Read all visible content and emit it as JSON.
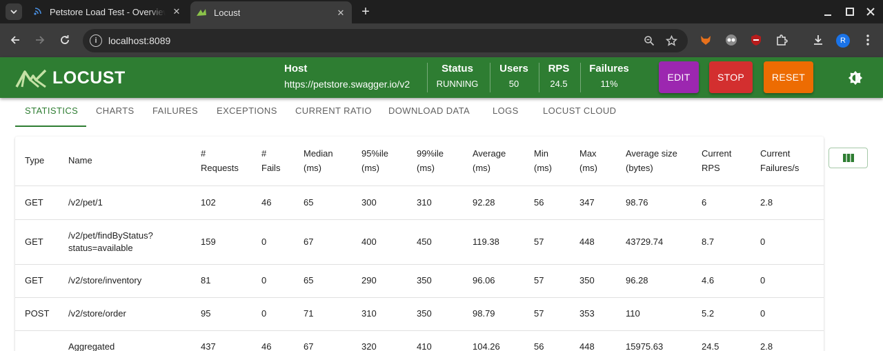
{
  "browser": {
    "tabs": [
      {
        "title": "Petstore Load Test - Overview",
        "active": false
      },
      {
        "title": "Locust",
        "active": true
      }
    ],
    "address": "localhost:8089",
    "profile_initial": "R"
  },
  "header": {
    "logo_text": "LOCUST",
    "host_label": "Host",
    "host_value": "https://petstore.swagger.io/v2",
    "status_label": "Status",
    "status_value": "RUNNING",
    "users_label": "Users",
    "users_value": "50",
    "rps_label": "RPS",
    "rps_value": "24.5",
    "failures_label": "Failures",
    "failures_value": "11%",
    "edit_label": "EDIT",
    "stop_label": "STOP",
    "reset_label": "RESET",
    "colors": {
      "header": "#2e7d32",
      "edit": "#9c27b0",
      "stop": "#d32f2f",
      "reset": "#ed6c02"
    }
  },
  "tabs": [
    "STATISTICS",
    "CHARTS",
    "FAILURES",
    "EXCEPTIONS",
    "CURRENT RATIO",
    "DOWNLOAD DATA",
    "LOGS",
    "LOCUST CLOUD"
  ],
  "active_tab": "STATISTICS",
  "table": {
    "headers": [
      [
        "Type"
      ],
      [
        "Name"
      ],
      [
        "#",
        "Requests"
      ],
      [
        "#",
        "Fails"
      ],
      [
        "Median",
        "(ms)"
      ],
      [
        "95%ile",
        "(ms)"
      ],
      [
        "99%ile",
        "(ms)"
      ],
      [
        "Average",
        "(ms)"
      ],
      [
        "Min",
        "(ms)"
      ],
      [
        "Max",
        "(ms)"
      ],
      [
        "Average size",
        "(bytes)"
      ],
      [
        "Current",
        "RPS"
      ],
      [
        "Current",
        "Failures/s"
      ]
    ],
    "rows": [
      {
        "cells": [
          "GET",
          "/v2/pet/1",
          "102",
          "46",
          "65",
          "300",
          "310",
          "92.28",
          "56",
          "347",
          "98.76",
          "6",
          "2.8"
        ]
      },
      {
        "cells": [
          "GET",
          "/v2/pet/findByStatus?",
          "159",
          "0",
          "67",
          "400",
          "450",
          "119.38",
          "57",
          "448",
          "43729.74",
          "8.7",
          "0"
        ],
        "name_line2": "status=available"
      },
      {
        "cells": [
          "GET",
          "/v2/store/inventory",
          "81",
          "0",
          "65",
          "290",
          "350",
          "96.06",
          "57",
          "350",
          "96.28",
          "4.6",
          "0"
        ]
      },
      {
        "cells": [
          "POST",
          "/v2/store/order",
          "95",
          "0",
          "71",
          "310",
          "350",
          "98.79",
          "57",
          "353",
          "110",
          "5.2",
          "0"
        ]
      },
      {
        "cells": [
          "",
          "Aggregated",
          "437",
          "46",
          "67",
          "320",
          "410",
          "104.26",
          "56",
          "448",
          "15975.63",
          "24.5",
          "2.8"
        ]
      }
    ]
  }
}
